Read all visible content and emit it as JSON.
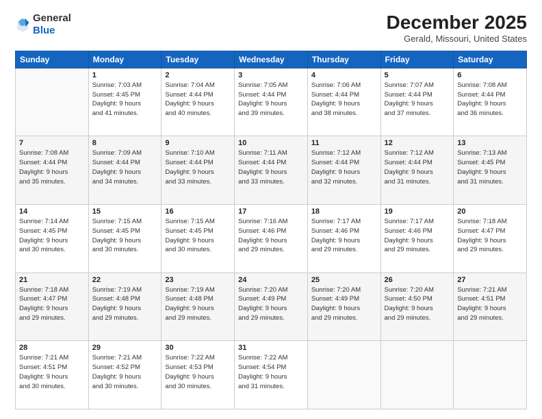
{
  "logo": {
    "general": "General",
    "blue": "Blue"
  },
  "header": {
    "month": "December 2025",
    "location": "Gerald, Missouri, United States"
  },
  "weekdays": [
    "Sunday",
    "Monday",
    "Tuesday",
    "Wednesday",
    "Thursday",
    "Friday",
    "Saturday"
  ],
  "weeks": [
    [
      {
        "num": "",
        "info": ""
      },
      {
        "num": "1",
        "info": "Sunrise: 7:03 AM\nSunset: 4:45 PM\nDaylight: 9 hours\nand 41 minutes."
      },
      {
        "num": "2",
        "info": "Sunrise: 7:04 AM\nSunset: 4:44 PM\nDaylight: 9 hours\nand 40 minutes."
      },
      {
        "num": "3",
        "info": "Sunrise: 7:05 AM\nSunset: 4:44 PM\nDaylight: 9 hours\nand 39 minutes."
      },
      {
        "num": "4",
        "info": "Sunrise: 7:06 AM\nSunset: 4:44 PM\nDaylight: 9 hours\nand 38 minutes."
      },
      {
        "num": "5",
        "info": "Sunrise: 7:07 AM\nSunset: 4:44 PM\nDaylight: 9 hours\nand 37 minutes."
      },
      {
        "num": "6",
        "info": "Sunrise: 7:08 AM\nSunset: 4:44 PM\nDaylight: 9 hours\nand 36 minutes."
      }
    ],
    [
      {
        "num": "7",
        "info": "Sunrise: 7:08 AM\nSunset: 4:44 PM\nDaylight: 9 hours\nand 35 minutes."
      },
      {
        "num": "8",
        "info": "Sunrise: 7:09 AM\nSunset: 4:44 PM\nDaylight: 9 hours\nand 34 minutes."
      },
      {
        "num": "9",
        "info": "Sunrise: 7:10 AM\nSunset: 4:44 PM\nDaylight: 9 hours\nand 33 minutes."
      },
      {
        "num": "10",
        "info": "Sunrise: 7:11 AM\nSunset: 4:44 PM\nDaylight: 9 hours\nand 33 minutes."
      },
      {
        "num": "11",
        "info": "Sunrise: 7:12 AM\nSunset: 4:44 PM\nDaylight: 9 hours\nand 32 minutes."
      },
      {
        "num": "12",
        "info": "Sunrise: 7:12 AM\nSunset: 4:44 PM\nDaylight: 9 hours\nand 31 minutes."
      },
      {
        "num": "13",
        "info": "Sunrise: 7:13 AM\nSunset: 4:45 PM\nDaylight: 9 hours\nand 31 minutes."
      }
    ],
    [
      {
        "num": "14",
        "info": "Sunrise: 7:14 AM\nSunset: 4:45 PM\nDaylight: 9 hours\nand 30 minutes."
      },
      {
        "num": "15",
        "info": "Sunrise: 7:15 AM\nSunset: 4:45 PM\nDaylight: 9 hours\nand 30 minutes."
      },
      {
        "num": "16",
        "info": "Sunrise: 7:15 AM\nSunset: 4:45 PM\nDaylight: 9 hours\nand 30 minutes."
      },
      {
        "num": "17",
        "info": "Sunrise: 7:16 AM\nSunset: 4:46 PM\nDaylight: 9 hours\nand 29 minutes."
      },
      {
        "num": "18",
        "info": "Sunrise: 7:17 AM\nSunset: 4:46 PM\nDaylight: 9 hours\nand 29 minutes."
      },
      {
        "num": "19",
        "info": "Sunrise: 7:17 AM\nSunset: 4:46 PM\nDaylight: 9 hours\nand 29 minutes."
      },
      {
        "num": "20",
        "info": "Sunrise: 7:18 AM\nSunset: 4:47 PM\nDaylight: 9 hours\nand 29 minutes."
      }
    ],
    [
      {
        "num": "21",
        "info": "Sunrise: 7:18 AM\nSunset: 4:47 PM\nDaylight: 9 hours\nand 29 minutes."
      },
      {
        "num": "22",
        "info": "Sunrise: 7:19 AM\nSunset: 4:48 PM\nDaylight: 9 hours\nand 29 minutes."
      },
      {
        "num": "23",
        "info": "Sunrise: 7:19 AM\nSunset: 4:48 PM\nDaylight: 9 hours\nand 29 minutes."
      },
      {
        "num": "24",
        "info": "Sunrise: 7:20 AM\nSunset: 4:49 PM\nDaylight: 9 hours\nand 29 minutes."
      },
      {
        "num": "25",
        "info": "Sunrise: 7:20 AM\nSunset: 4:49 PM\nDaylight: 9 hours\nand 29 minutes."
      },
      {
        "num": "26",
        "info": "Sunrise: 7:20 AM\nSunset: 4:50 PM\nDaylight: 9 hours\nand 29 minutes."
      },
      {
        "num": "27",
        "info": "Sunrise: 7:21 AM\nSunset: 4:51 PM\nDaylight: 9 hours\nand 29 minutes."
      }
    ],
    [
      {
        "num": "28",
        "info": "Sunrise: 7:21 AM\nSunset: 4:51 PM\nDaylight: 9 hours\nand 30 minutes."
      },
      {
        "num": "29",
        "info": "Sunrise: 7:21 AM\nSunset: 4:52 PM\nDaylight: 9 hours\nand 30 minutes."
      },
      {
        "num": "30",
        "info": "Sunrise: 7:22 AM\nSunset: 4:53 PM\nDaylight: 9 hours\nand 30 minutes."
      },
      {
        "num": "31",
        "info": "Sunrise: 7:22 AM\nSunset: 4:54 PM\nDaylight: 9 hours\nand 31 minutes."
      },
      {
        "num": "",
        "info": ""
      },
      {
        "num": "",
        "info": ""
      },
      {
        "num": "",
        "info": ""
      }
    ]
  ]
}
